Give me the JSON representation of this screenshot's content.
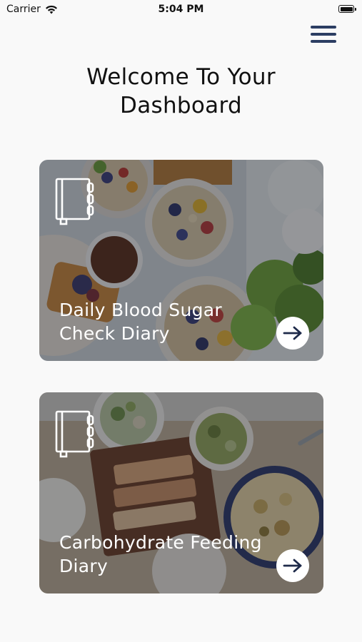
{
  "status_bar": {
    "carrier": "Carrier",
    "time": "5:04 PM",
    "icons": [
      "wifi-icon",
      "battery-icon"
    ]
  },
  "header": {
    "menu_icon": "hamburger-menu-icon",
    "title": "Welcome To Your Dashboard"
  },
  "cards": [
    {
      "title": "Daily Blood Sugar Check Diary",
      "icon": "notebook-icon",
      "action_icon": "arrow-right-icon"
    },
    {
      "title": "Carbohydrate Feeding Diary",
      "icon": "notebook-icon",
      "action_icon": "arrow-right-icon"
    }
  ],
  "colors": {
    "accent": "#2c3e63",
    "background": "#f9f9f9",
    "card_text": "#ffffff"
  }
}
